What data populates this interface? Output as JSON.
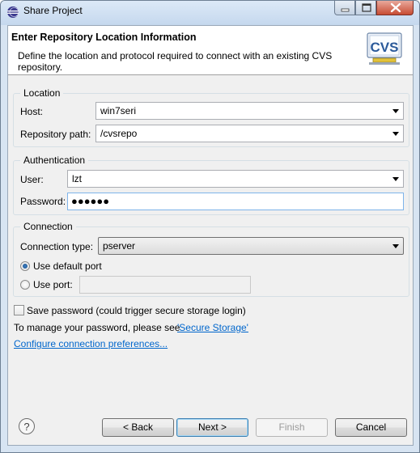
{
  "window": {
    "title": "Share Project"
  },
  "banner": {
    "title": "Enter Repository Location Information",
    "description": "Define the location and protocol required to connect with an existing CVS repository.",
    "icon_text": "CVS"
  },
  "location": {
    "legend": "Location",
    "host_label": "Host:",
    "host_value": "win7seri",
    "path_label": "Repository path:",
    "path_value": "/cvsrepo"
  },
  "authentication": {
    "legend": "Authentication",
    "user_label": "User:",
    "user_value": "lzt",
    "password_label": "Password:",
    "password_value": "●●●●●●"
  },
  "connection": {
    "legend": "Connection",
    "type_label": "Connection type:",
    "type_value": "pserver",
    "default_port_label": "Use default port",
    "use_port_label": "Use port:",
    "port_value": ""
  },
  "save_password_label": "Save password (could trigger secure storage login)",
  "manage_text": "To manage your password, please see",
  "secure_storage_link": "'Secure Storage'",
  "configure_link": "Configure connection preferences...",
  "buttons": {
    "help": "?",
    "back": "< Back",
    "next": "Next >",
    "finish": "Finish",
    "cancel": "Cancel"
  }
}
